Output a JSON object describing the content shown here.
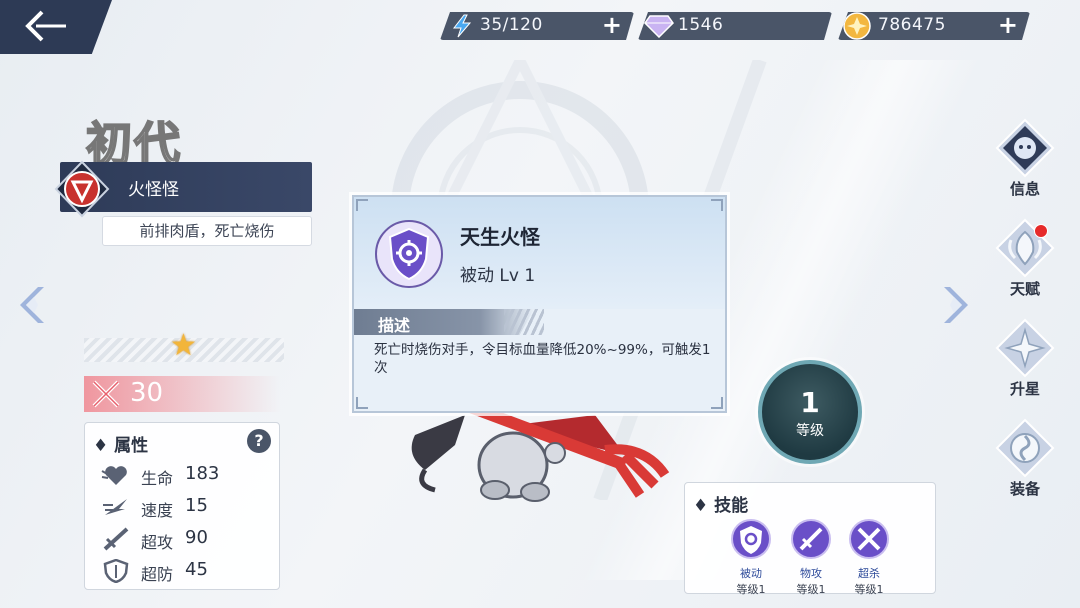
{
  "resources": {
    "energy": "35/120",
    "diamond": "1546",
    "gold": "786475"
  },
  "character": {
    "title": "初代",
    "type_name": "火怪怪",
    "type_desc": "前排肉盾，死亡烧伤",
    "power": "30"
  },
  "attributes": {
    "header": "属性",
    "help": "?",
    "rows": [
      {
        "name": "生命",
        "value": "183",
        "icon": "heart-wing-icon"
      },
      {
        "name": "速度",
        "value": "15",
        "icon": "speed-wing-icon"
      },
      {
        "name": "超攻",
        "value": "90",
        "icon": "sword-icon"
      },
      {
        "name": "超防",
        "value": "45",
        "icon": "shield-icon"
      }
    ]
  },
  "popup": {
    "skill_name": "天生火怪",
    "skill_level": "被动 Lv 1",
    "desc_label": "描述",
    "desc_text": "死亡时烧伤对手，令目标血量降低20%~99%，可触发1次"
  },
  "level": {
    "num": "1",
    "label": "等级"
  },
  "skills": {
    "header": "技能",
    "items": [
      {
        "name": "被动",
        "level": "等级1"
      },
      {
        "name": "物攻",
        "level": "等级1"
      },
      {
        "name": "超杀",
        "level": "等级1"
      }
    ]
  },
  "menu": [
    {
      "label": "信息"
    },
    {
      "label": "天赋"
    },
    {
      "label": "升星"
    },
    {
      "label": "装备"
    }
  ],
  "colors": {
    "accent": "#2e3b58",
    "skill_purple": "#6a4fc8",
    "power_red": "#f07882"
  }
}
